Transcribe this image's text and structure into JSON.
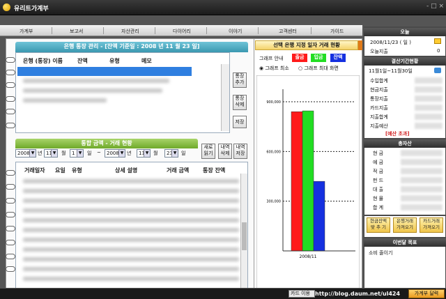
{
  "window": {
    "title": "유리트가계부",
    "controls": "- □ ×"
  },
  "nav": [
    "가계부",
    "보고서",
    "자산관리",
    "다이어리",
    "이야기",
    "고객센터",
    "가이드"
  ],
  "account": {
    "title": "은행 통장 관리 - [잔액 기준일 : 2008 년 11 월 23 일]",
    "headers": [
      "은행 (통장) 이름",
      "잔액",
      "유형",
      "메모"
    ],
    "buttons": [
      "통장\n추가",
      "통장\n삭제",
      "저장"
    ]
  },
  "transactions": {
    "title": "통합 금액 - 거래 현황",
    "from": {
      "year": "2008",
      "month": "11",
      "day": "1"
    },
    "to": {
      "year": "2008",
      "month": "11",
      "day": "23"
    },
    "labels": {
      "year": "년",
      "month": "월",
      "day": "일",
      "tilde": "~"
    },
    "buttons": [
      "새로\n읽기",
      "내역\n삭제",
      "내역\n저장"
    ],
    "headers": [
      "거래일자",
      "요일",
      "유형",
      "상세 설명",
      "거래 금액",
      "통장 잔액"
    ]
  },
  "graph": {
    "title": "선택 은행 지정 일자 거래 현황",
    "guide_label": "그래프 안내",
    "legend": [
      {
        "label": "출금",
        "color": "#ff1a1a"
      },
      {
        "label": "입금",
        "color": "#22dd22"
      },
      {
        "label": "잔액",
        "color": "#1530e0"
      }
    ],
    "radio": [
      {
        "label": "그래프 최소",
        "checked": true
      },
      {
        "label": "그래프 최대 화면",
        "checked": false
      }
    ]
  },
  "chart_data": {
    "type": "bar",
    "categories": [
      "2008/11"
    ],
    "series": [
      {
        "name": "출금",
        "values": [
          840000
        ],
        "color": "#ff1a1a"
      },
      {
        "name": "입금",
        "values": [
          845000
        ],
        "color": "#22dd22"
      },
      {
        "name": "잔액",
        "values": [
          420000
        ],
        "color": "#1530e0"
      }
    ],
    "yticks": [
      "900,000",
      "600,000",
      "300,000"
    ],
    "ylim": [
      0,
      900000
    ],
    "grid": true
  },
  "today": {
    "header": "오늘",
    "date": "2008/11/23 ( 일 )",
    "spend_label": "오늘지출",
    "spend_value": "0"
  },
  "settlement": {
    "header": "결산기간현황",
    "period": "11월1일~11월30일",
    "rows": [
      "수입합계",
      "현금지출",
      "통장지출",
      "카드지출",
      "지출합계",
      "지출예산"
    ],
    "warning": "[예산 초과]"
  },
  "assets": {
    "header": "총자산",
    "rows": [
      "현 금",
      "예 금",
      "적 금",
      "펀 드",
      "대 출",
      "현 물",
      "합 계"
    ],
    "buttons": [
      "현금잔액\n맞 추 기",
      "은행거래\n가져오기",
      "카드거래\n가져오기"
    ]
  },
  "memo": {
    "header": "이번달 목표",
    "text": "소비 줄이기"
  },
  "status": {
    "left": "카드 이용",
    "url": "http://blog.daum.net/ul424",
    "right_btn": "가계부 달력"
  }
}
